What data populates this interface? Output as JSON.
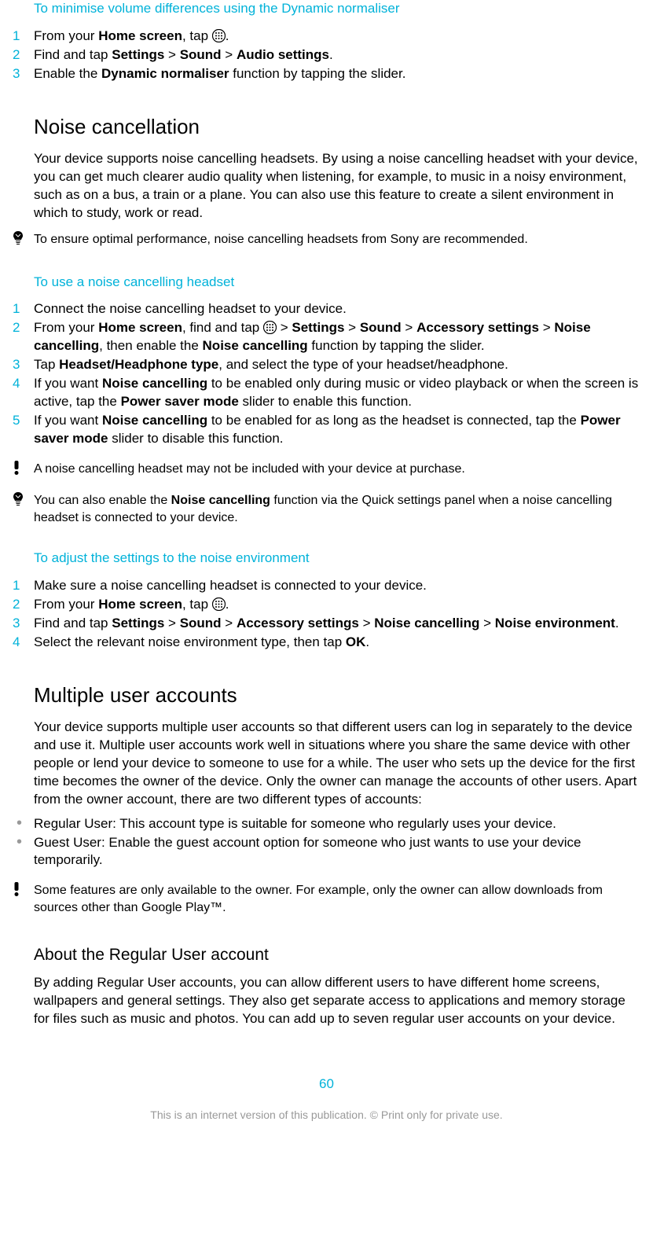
{
  "sec1": {
    "title": "To minimise volume differences using the Dynamic normaliser",
    "step1a": "From your ",
    "step1b": "Home screen",
    "step1c": ", tap ",
    "step1d": ".",
    "step2a": "Find and tap ",
    "step2b": "Settings",
    "step2c": " > ",
    "step2d": "Sound",
    "step2e": " > ",
    "step2f": "Audio settings",
    "step2g": ".",
    "step3a": "Enable the ",
    "step3b": "Dynamic normaliser",
    "step3c": " function by tapping the slider."
  },
  "noise": {
    "heading": "Noise cancellation",
    "intro": "Your device supports noise cancelling headsets. By using a noise cancelling headset with your device, you can get much clearer audio quality when listening, for example, to music in a noisy environment, such as on a bus, a train or a plane. You can also use this feature to create a silent environment in which to study, work or read.",
    "tip": "To ensure optimal performance, noise cancelling headsets from Sony are recommended."
  },
  "useHeadset": {
    "title": "To use a noise cancelling headset",
    "s1": "Connect the noise cancelling headset to your device.",
    "s2a": "From your ",
    "s2b": "Home screen",
    "s2c": ", find and tap ",
    "s2d": " > ",
    "s2e": "Settings",
    "s2f": " > ",
    "s2g": "Sound",
    "s2h": " > ",
    "s2i": "Accessory settings",
    "s2j": " > ",
    "s2k": "Noise cancelling",
    "s2l": ", then enable the ",
    "s2m": "Noise cancelling",
    "s2n": " function by tapping the slider.",
    "s3a": "Tap ",
    "s3b": "Headset/Headphone type",
    "s3c": ", and select the type of your headset/headphone.",
    "s4a": "If you want ",
    "s4b": "Noise cancelling",
    "s4c": " to be enabled only during music or video playback or when the screen is active, tap the ",
    "s4d": "Power saver mode",
    "s4e": " slider to enable this function.",
    "s5a": "If you want ",
    "s5b": "Noise cancelling",
    "s5c": " to be enabled for as long as the headset is connected, tap the ",
    "s5d": "Power saver mode",
    "s5e": " slider to disable this function.",
    "warn": "A noise cancelling headset may not be included with your device at purchase.",
    "tip2a": "You can also enable the ",
    "tip2b": "Noise cancelling",
    "tip2c": " function via the Quick settings panel when a noise cancelling headset is connected to your device."
  },
  "adjust": {
    "title": "To adjust the settings to the noise environment",
    "s1": "Make sure a noise cancelling headset is connected to your device.",
    "s2a": "From your ",
    "s2b": "Home screen",
    "s2c": ", tap ",
    "s2d": ".",
    "s3a": "Find and tap ",
    "s3b": "Settings",
    "s3c": " > ",
    "s3d": "Sound",
    "s3e": " > ",
    "s3f": "Accessory settings",
    "s3g": " > ",
    "s3h": "Noise cancelling",
    "s3i": " > ",
    "s3j": "Noise environment",
    "s3k": ".",
    "s4a": "Select the relevant noise environment type, then tap ",
    "s4b": "OK",
    "s4c": "."
  },
  "multi": {
    "heading": "Multiple user accounts",
    "intro": "Your device supports multiple user accounts so that different users can log in separately to the device and use it. Multiple user accounts work well in situations where you share the same device with other people or lend your device to someone to use for a while. The user who sets up the device for the first time becomes the owner of the device. Only the owner can manage the accounts of other users. Apart from the owner account, there are two different types of accounts:",
    "b1": "Regular User: This account type is suitable for someone who regularly uses your device.",
    "b2": "Guest User: Enable the guest account option for someone who just wants to use your device temporarily.",
    "warn": "Some features are only available to the owner. For example, only the owner can allow downloads from sources other than Google Play™."
  },
  "regular": {
    "heading": "About the Regular User account",
    "para": "By adding Regular User accounts, you can allow different users to have different home screens, wallpapers and general settings. They also get separate access to applications and memory storage for files such as music and photos. You can add up to seven regular user accounts on your device."
  },
  "pageNum": "60",
  "footer": "This is an internet version of this publication. © Print only for private use."
}
